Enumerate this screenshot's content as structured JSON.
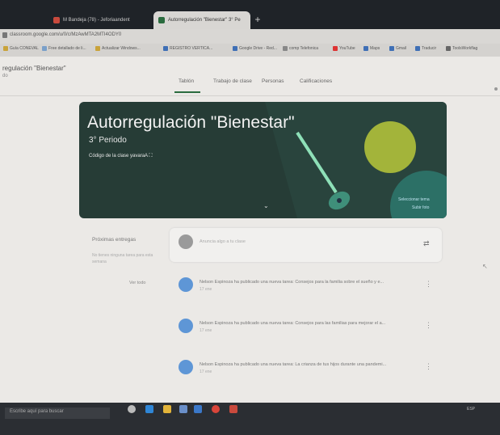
{
  "browser": {
    "tabs": [
      {
        "label": "M Bandeja (78) - Jeforiaandent",
        "active": false
      },
      {
        "label": "Autorregulación \"Bienestar\" 3° Pe",
        "active": true
      }
    ],
    "new_tab": "+",
    "address": "classroom.google.com/u/0/c/MzAwMTA2MTI4ODY0",
    "bookmarks": [
      "Guía CONEVAL",
      "Free detallado de li...",
      "Actualizar Windows...",
      "REGISTRO VERTICA...",
      "Google Drive - Red...",
      "comp Telefonica",
      "YouTube",
      "Maps",
      "Gmail",
      "Traducir",
      "ToolsWorkflag"
    ]
  },
  "classroom": {
    "class_name": "regulación \"Bienestar\"",
    "class_sub": "do",
    "nav_tabs": [
      "Tablón",
      "Trabajo de clase",
      "Personas",
      "Calificaciones"
    ],
    "banner": {
      "title": "Autorregulación \"Bienestar\"",
      "period": "3° Periodo",
      "code_label": "Código de la clase",
      "code_value": "yavaraA",
      "select_theme": "Seleccionar tema",
      "upload_photo": "Subir foto"
    },
    "upcoming": {
      "title": "Próximas entregas",
      "body": "No tienes ninguna tarea para esta semana",
      "link": "Ver todo"
    },
    "announce_placeholder": "Anuncia algo a tu clase",
    "posts": [
      {
        "title": "Nelson Espinoza ha publicado una nueva tarea: Consejos para la familia sobre el sueño y e...",
        "date": "17 ene"
      },
      {
        "title": "Nelson Espinoza ha publicado una nueva tarea: Consejos para las familias para mejorar el a...",
        "date": "17 ene"
      },
      {
        "title": "Nelson Espinoza ha publicado una nueva tarea: La crianza de tus hijos durante una pandemi...",
        "date": "17 ene"
      }
    ]
  },
  "taskbar": {
    "search_placeholder": "Escribe aquí para buscar",
    "tray": "ESP"
  },
  "colors": {
    "banner": "#263c36",
    "accent": "#2a6b3e",
    "post_icon": "#5e96d6"
  }
}
